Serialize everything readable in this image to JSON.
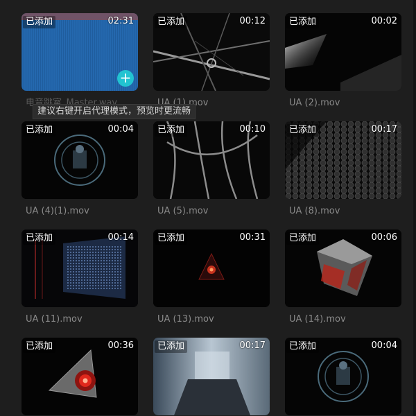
{
  "tooltip": "建议右键开启代理模式，预览时更流畅",
  "items": [
    {
      "badge": "已添加",
      "duration": "02:31",
      "name": "电音跳室_Master.wav",
      "has_add": true
    },
    {
      "badge": "已添加",
      "duration": "00:12",
      "name": "UA (1).mov"
    },
    {
      "badge": "已添加",
      "duration": "00:02",
      "name": "UA (2).mov"
    },
    {
      "badge": "已添加",
      "duration": "00:04",
      "name": "UA (4)(1).mov"
    },
    {
      "badge": "已添加",
      "duration": "00:10",
      "name": "UA (5).mov"
    },
    {
      "badge": "已添加",
      "duration": "00:17",
      "name": "UA (8).mov"
    },
    {
      "badge": "已添加",
      "duration": "00:14",
      "name": "UA (11).mov"
    },
    {
      "badge": "已添加",
      "duration": "00:31",
      "name": "UA (13).mov"
    },
    {
      "badge": "已添加",
      "duration": "00:06",
      "name": "UA (14).mov"
    },
    {
      "badge": "已添加",
      "duration": "00:36",
      "name": ""
    },
    {
      "badge": "已添加",
      "duration": "00:17",
      "name": ""
    },
    {
      "badge": "已添加",
      "duration": "00:04",
      "name": ""
    }
  ],
  "add_symbol": "+",
  "colors": {
    "background": "#1e1e1e",
    "accent": "#22c3d1",
    "audio_blue": "#1e5fa6"
  }
}
